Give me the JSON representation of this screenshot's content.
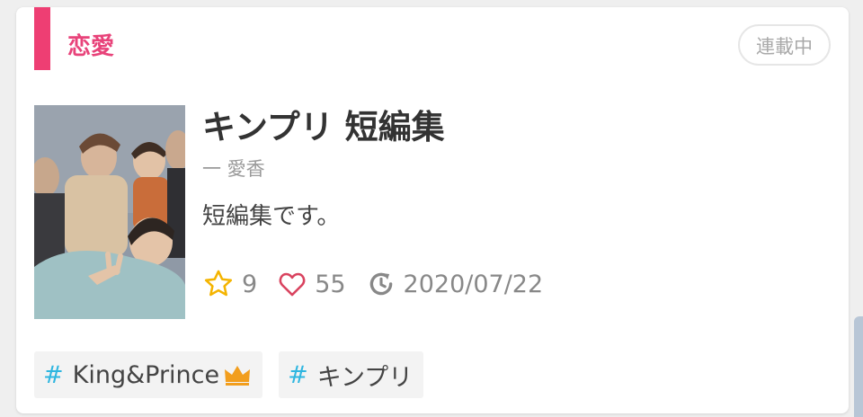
{
  "card": {
    "genre": "恋愛",
    "status": "連載中",
    "title": "キンプリ 短編集",
    "author": "一 愛香",
    "description": "短編集です。",
    "stats": {
      "stars": "9",
      "likes": "55",
      "updated": "2020/07/22"
    },
    "tags": [
      {
        "hash": "#",
        "label": "King&Prince"
      },
      {
        "hash": "#",
        "label": "キンプリ"
      }
    ],
    "cover_icon": "group-photo"
  },
  "colors": {
    "accent": "#ee3e73",
    "genre_text": "#e8437a",
    "star": "#f4b400",
    "heart": "#d9435f",
    "hash": "#2fb6e0",
    "crown": "#f29e1d"
  }
}
